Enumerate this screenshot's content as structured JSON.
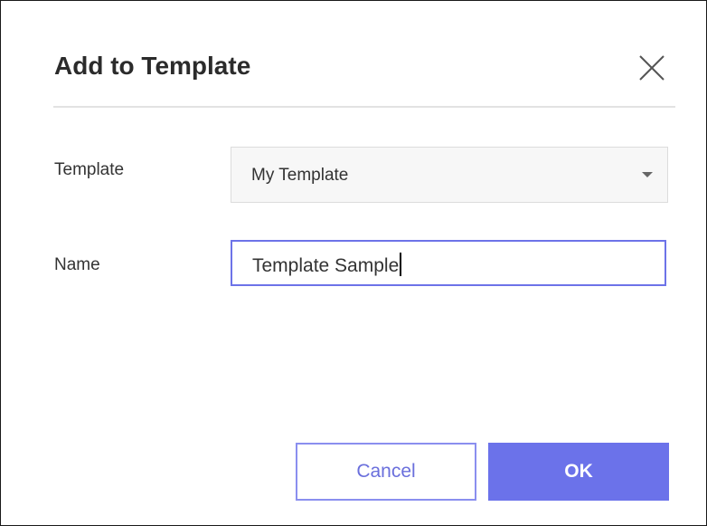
{
  "dialog": {
    "title": "Add to Template",
    "close_icon": "close-icon",
    "fields": {
      "template": {
        "label": "Template",
        "selected": "My Template",
        "icon": "caret-down-icon"
      },
      "name": {
        "label": "Name",
        "value": "Template Sample"
      }
    },
    "buttons": {
      "cancel": "Cancel",
      "ok": "OK"
    }
  },
  "colors": {
    "accent": "#6b72ea",
    "cancel_border": "#8a8fef",
    "cancel_text": "#6a6fdc",
    "input_focus_border": "#6d73e8",
    "select_background": "#f7f7f7",
    "divider": "#e2e2e2",
    "title_text": "#2b2b2b"
  }
}
